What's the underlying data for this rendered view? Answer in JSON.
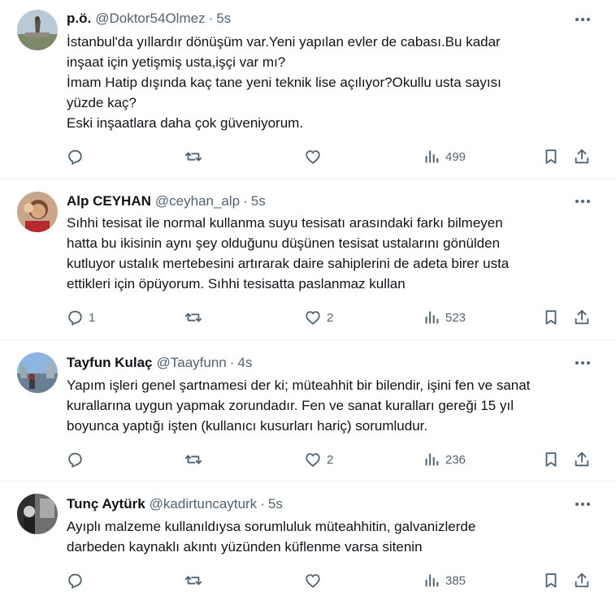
{
  "tweets": [
    {
      "name": "p.ö.",
      "handle": "@Doktor54Olmez",
      "separator": "·",
      "time": "5s",
      "lines": [
        "İstanbul'da yıllardır dönüşüm var.Yeni yapılan evler de cabası.Bu kadar",
        "inşaat için yetişmiş usta,işçi var mı?",
        "İmam Hatip dışında kaç tane yeni teknik lise açılıyor?Okullu usta sayısı",
        "yüzde kaç?",
        "Eski inşaatlara daha çok güveniyorum."
      ],
      "replies": "",
      "retweets": "",
      "likes": "",
      "views": "499"
    },
    {
      "name": "Alp CEYHAN",
      "handle": "@ceyhan_alp",
      "separator": "·",
      "time": "5s",
      "lines": [
        "Sıhhi tesisat ile normal kullanma suyu tesisatı arasındaki farkı bilmeyen",
        "hatta bu ikisinin aynı şey olduğunu düşünen tesisat ustalarını gönülden",
        "kutluyor ustalık mertebesini artırarak daire sahiplerini de adeta birer usta",
        "ettikleri için öpüyorum. Sıhhi tesisatta paslanmaz kullan"
      ],
      "replies": "1",
      "retweets": "",
      "likes": "2",
      "views": "523"
    },
    {
      "name": "Tayfun Kulaç",
      "handle": "@Taayfunn",
      "separator": "·",
      "time": "4s",
      "lines": [
        "Yapım işleri genel şartnamesi der ki; müteahhit bir bilendir, işini fen ve sanat",
        "kurallarına uygun yapmak zorundadır. Fen ve sanat kuralları gereği 15 yıl",
        "boyunca yaptığı işten (kullanıcı kusurları hariç) sorumludur."
      ],
      "replies": "",
      "retweets": "",
      "likes": "2",
      "views": "236"
    },
    {
      "name": "Tunç Aytürk",
      "handle": "@kadirtuncayturk",
      "separator": "·",
      "time": "5s",
      "lines": [
        "Ayıplı malzeme kullanıldıysa sorumluluk müteahhitin, galvanizlerde",
        "darbeden kaynaklı akıntı yüzünden küflenme varsa sitenin"
      ],
      "replies": "",
      "retweets": "",
      "likes": "",
      "views": "385"
    }
  ]
}
